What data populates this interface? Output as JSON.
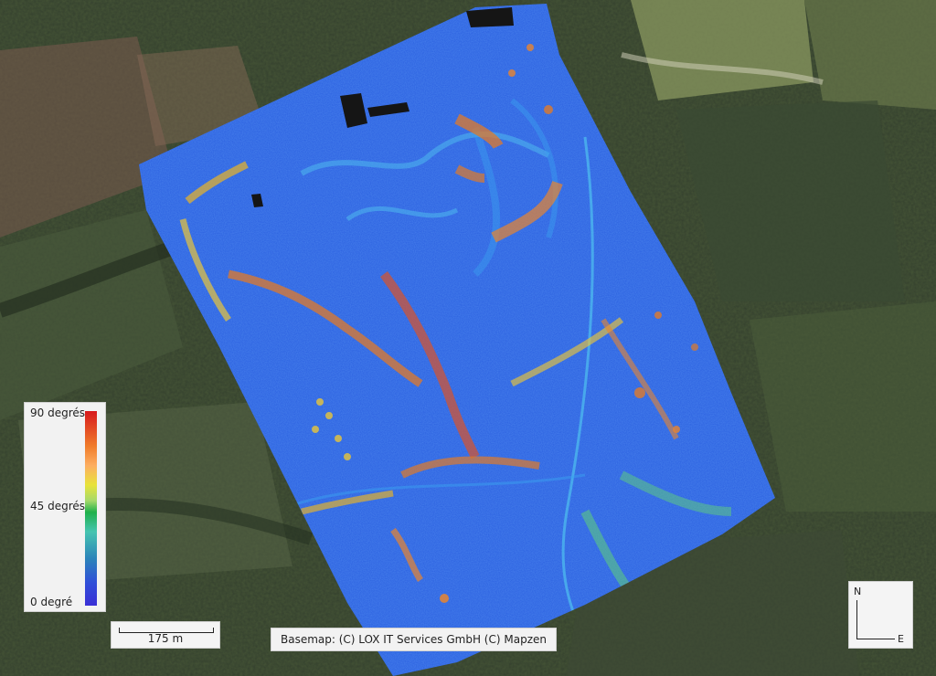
{
  "map": {
    "basemap": "satellite-imagery",
    "overlay": "slope-raster",
    "colors": {
      "overlay_base": "#2a5fe0",
      "overlay_light": "#3aa0f0",
      "low": "#3a2fd6",
      "mid": "#1eb04a",
      "high": "#d7191c",
      "vegetation": "#2f3a2a",
      "field_light": "#9aa874"
    }
  },
  "legend": {
    "max_label": "90 degrés",
    "mid_label": "45 degrés",
    "min_label": "0 degré"
  },
  "scalebar": {
    "label": "175 m"
  },
  "attribution": {
    "text": "Basemap: (C)                    LOX IT Services GmbH (C) Mapzen"
  },
  "north_arrow": {
    "n_label": "N",
    "e_label": "E"
  }
}
